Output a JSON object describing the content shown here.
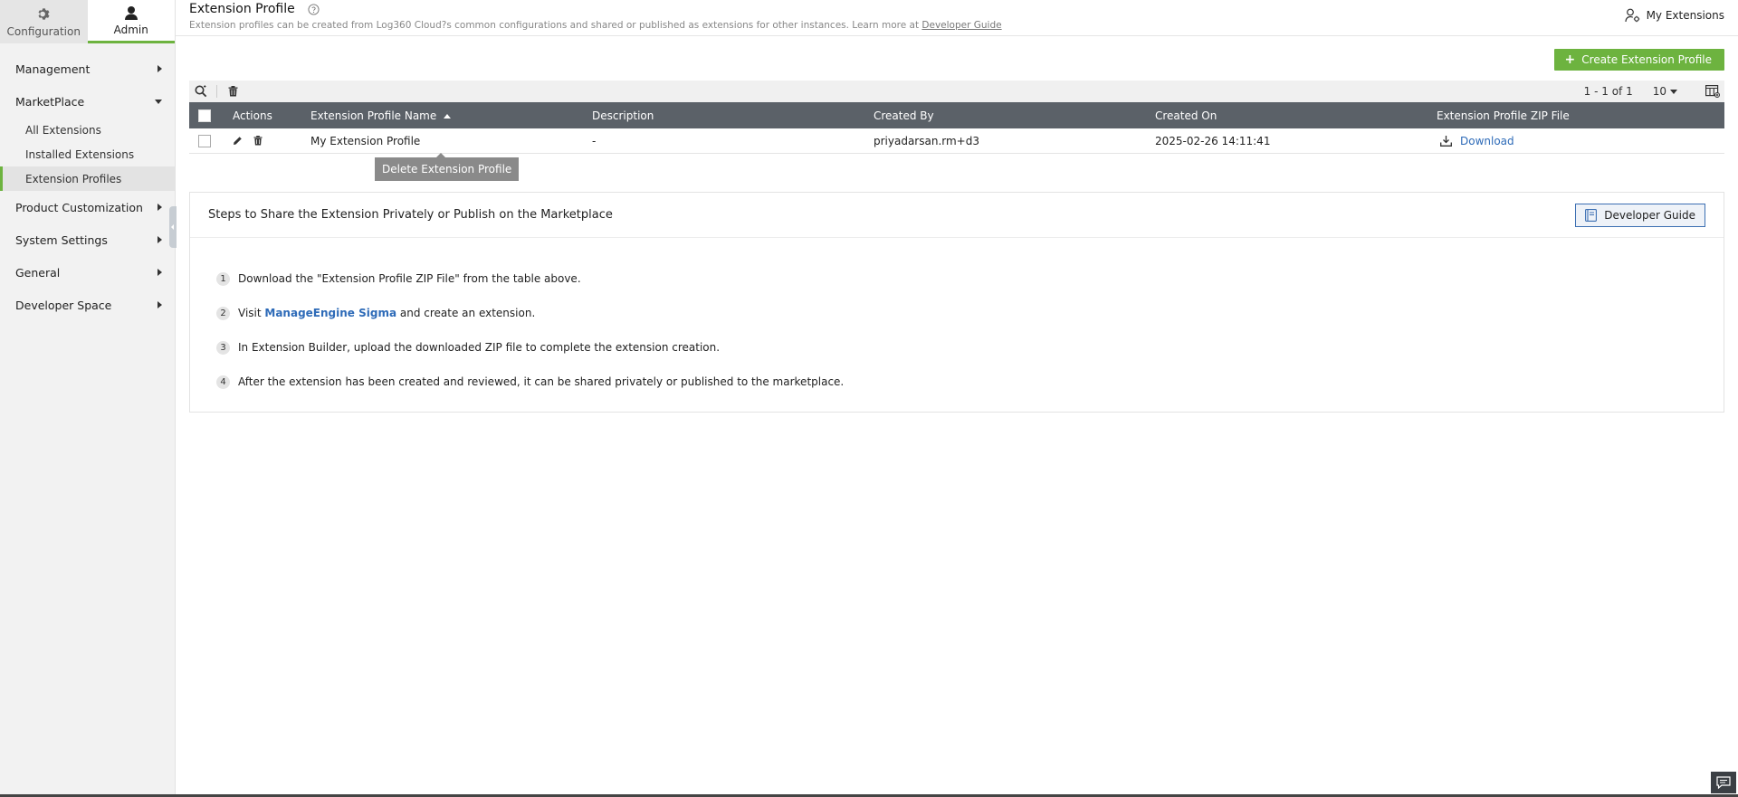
{
  "sidebar": {
    "tabs": [
      {
        "label": "Configuration",
        "icon": "gear-icon"
      },
      {
        "label": "Admin",
        "icon": "user-icon"
      }
    ],
    "menu": {
      "management": "Management",
      "marketplace": "MarketPlace",
      "marketplace_items": [
        "All Extensions",
        "Installed Extensions",
        "Extension Profiles"
      ],
      "product_customization": "Product Customization",
      "system_settings": "System Settings",
      "general": "General",
      "developer_space": "Developer Space"
    }
  },
  "header": {
    "title": "Extension Profile",
    "subtitle": "Extension profiles can be created from Log360 Cloud?s common configurations and shared or published as extensions for other instances. Learn more at ",
    "subtitle_link": "Developer Guide",
    "my_extensions": "My Extensions"
  },
  "create_button": {
    "plus": "+",
    "label": "Create Extension Profile"
  },
  "pager": {
    "range": "1 - 1 of 1",
    "page_size": "10"
  },
  "table": {
    "headers": {
      "actions": "Actions",
      "name": "Extension Profile Name",
      "description": "Description",
      "created_by": "Created By",
      "created_on": "Created On",
      "zip": "Extension Profile ZIP File"
    },
    "rows": [
      {
        "name": "My Extension Profile",
        "description": "-",
        "created_by": "priyadarsan.rm+d3",
        "created_on": "2025-02-26 14:11:41",
        "zip": "Download"
      }
    ]
  },
  "tooltip": "Delete Extension Profile",
  "steps": {
    "title": "Steps to Share the Extension Privately or Publish on the Marketplace",
    "button": "Developer Guide",
    "items": [
      {
        "num": "1",
        "text": "Download the \"Extension Profile ZIP File\" from the table above."
      },
      {
        "num": "2",
        "pre": "Visit ",
        "link": "ManageEngine Sigma",
        "post": " and create an extension."
      },
      {
        "num": "3",
        "text": "In Extension Builder, upload the downloaded ZIP file to complete the extension creation."
      },
      {
        "num": "4",
        "text": "After the extension has been created and reviewed, it can be shared privately or published to the marketplace."
      }
    ]
  },
  "colors": {
    "accent": "#6db33f",
    "header_bg": "#5b6168",
    "link": "#2e6bb8"
  }
}
